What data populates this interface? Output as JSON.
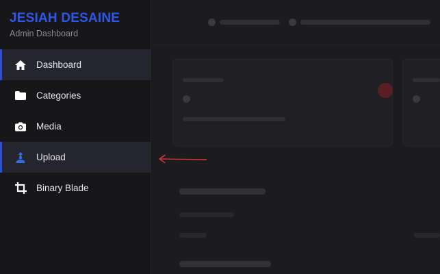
{
  "brand": {
    "title": "JESIAH DESAINE",
    "subtitle": "Admin Dashboard"
  },
  "sidebar": {
    "items": [
      {
        "label": "Dashboard",
        "icon": "home-icon",
        "active": true
      },
      {
        "label": "Categories",
        "icon": "folder-icon",
        "active": false
      },
      {
        "label": "Media",
        "icon": "camera-icon",
        "active": false
      },
      {
        "label": "Upload",
        "icon": "upload-user-icon",
        "active": true
      },
      {
        "label": "Binary Blade",
        "icon": "crop-icon",
        "active": false
      }
    ]
  },
  "colors": {
    "brand": "#2f56ea",
    "active_indicator": "#2f4ed8",
    "annotation_arrow": "#d9343a",
    "upload_icon": "#2f6fe0"
  }
}
